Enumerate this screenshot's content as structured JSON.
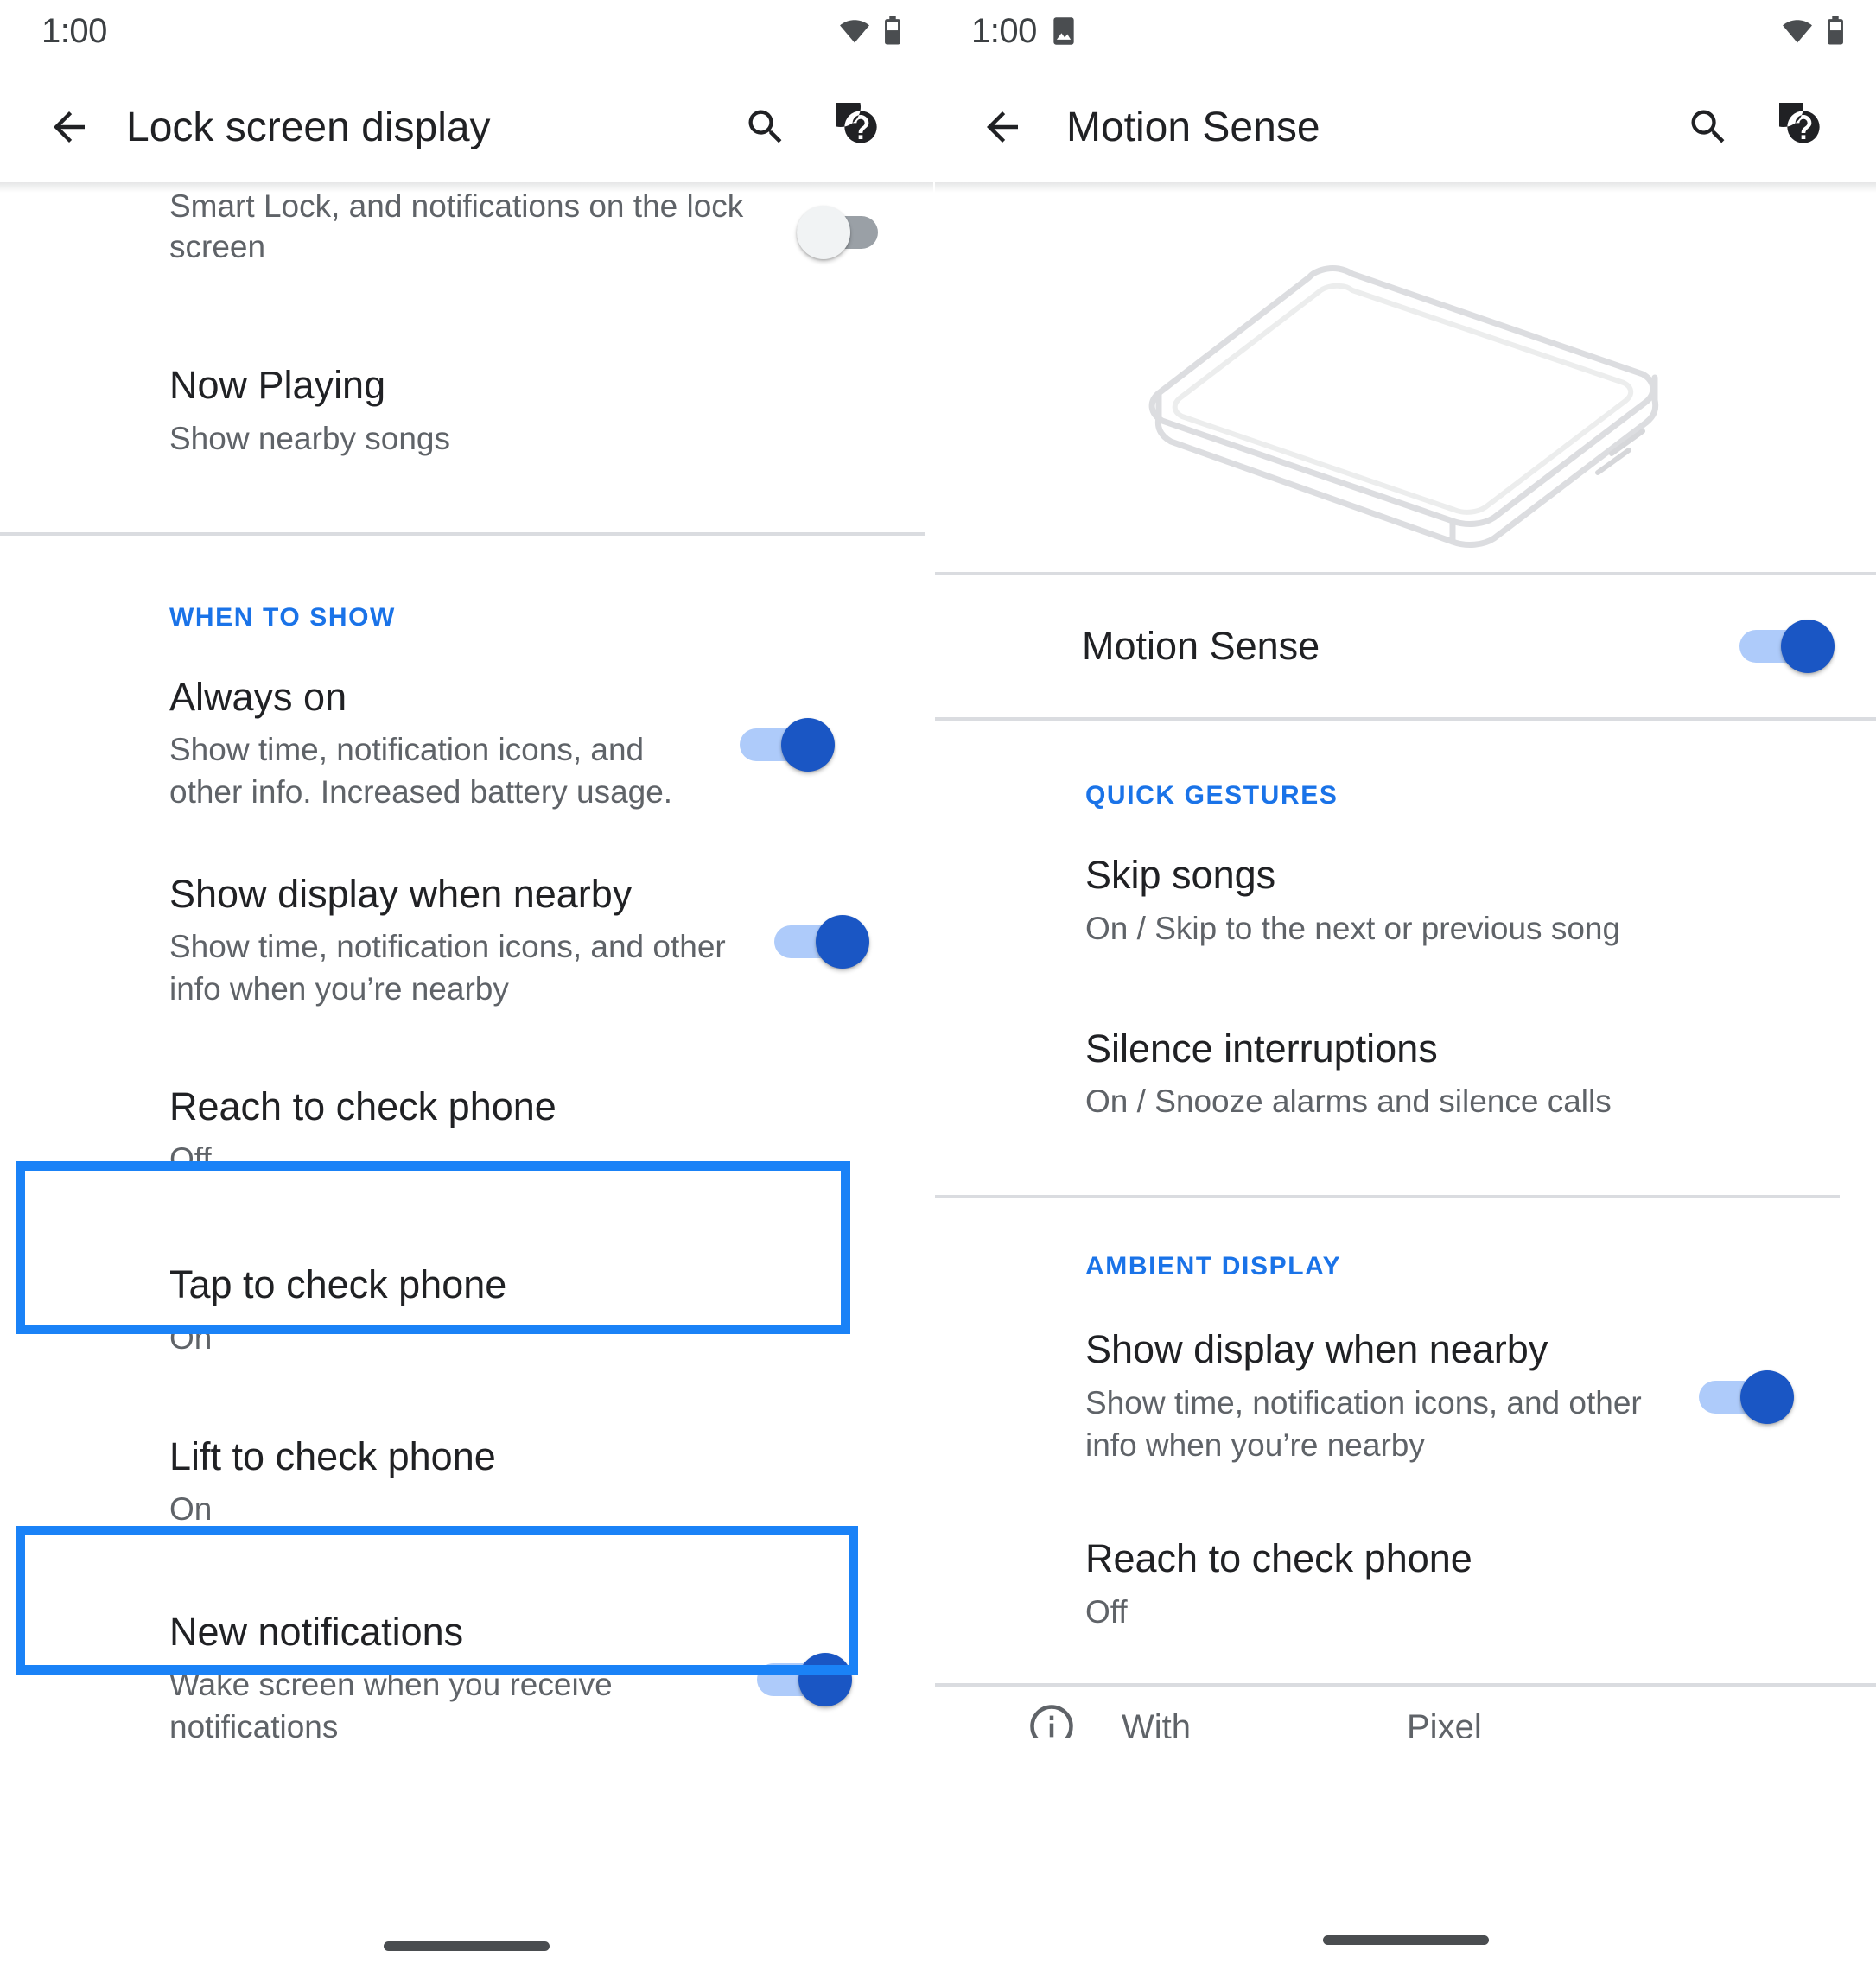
{
  "colors": {
    "accent_blue": "#1a73e8",
    "highlight_blue": "#1a82f7",
    "toggle_on_track": "#aecbfa",
    "toggle_on_thumb": "#1a56c4",
    "toggle_off_track": "#9aa0a6",
    "text_primary": "#202124",
    "text_secondary": "#5f6368",
    "divider": "#dadce0"
  },
  "left_panel": {
    "statusbar": {
      "time": "1:00",
      "icons": [
        "wifi-icon",
        "battery-icon"
      ]
    },
    "appbar": {
      "back_icon": "back-arrow-icon",
      "title": "Lock screen display",
      "search_icon": "search-icon",
      "help_icon": "help-icon"
    },
    "items": [
      {
        "name": "display-power-button-option",
        "title": "",
        "sub": "Display power button option that turns off Smart Lock, and notifications on the lock screen",
        "toggle": "off",
        "clipped_top": true
      },
      {
        "name": "now-playing",
        "title": "Now Playing",
        "sub": "Show nearby songs",
        "toggle": null
      }
    ],
    "section_when_to_show": {
      "header": "WHEN TO SHOW",
      "items": [
        {
          "name": "always-on",
          "title": "Always on",
          "sub": "Show time, notification icons, and other info. Increased battery usage.",
          "toggle": "on"
        },
        {
          "name": "show-display-when-nearby",
          "title": "Show display when nearby",
          "sub": "Show time, notification icons, and other info when you’re nearby",
          "toggle": "on"
        },
        {
          "name": "reach-to-check-phone",
          "title": "Reach to check phone",
          "sub": "Off",
          "toggle": null,
          "highlighted": true
        },
        {
          "name": "tap-to-check-phone",
          "title": "Tap to check phone",
          "sub": "On",
          "toggle": null
        },
        {
          "name": "lift-to-check-phone",
          "title": "Lift to check phone",
          "sub": "On",
          "toggle": null,
          "highlighted": true
        },
        {
          "name": "new-notifications",
          "title": "New notifications",
          "sub": "Wake screen when you receive notifications",
          "toggle": "on"
        }
      ]
    }
  },
  "right_panel": {
    "statusbar": {
      "time": "1:00",
      "icons": [
        "screenshot-icon",
        "wifi-icon",
        "battery-icon"
      ]
    },
    "appbar": {
      "back_icon": "back-arrow-icon",
      "title": "Motion Sense",
      "search_icon": "search-icon",
      "help_icon": "help-icon"
    },
    "illustration": "phone-isometric-illustration",
    "master_toggle": {
      "name": "motion-sense",
      "title": "Motion Sense",
      "toggle": "on",
      "highlighted": true
    },
    "section_quick_gestures": {
      "header": "QUICK GESTURES",
      "items": [
        {
          "name": "skip-songs",
          "title": "Skip songs",
          "sub": "On / Skip to the next or previous song"
        },
        {
          "name": "silence-interruptions",
          "title": "Silence interruptions",
          "sub": "On / Snooze alarms and silence calls"
        }
      ]
    },
    "section_ambient_display": {
      "header": "AMBIENT DISPLAY",
      "highlighted": true,
      "items": [
        {
          "name": "show-display-when-nearby",
          "title": "Show display when nearby",
          "sub": "Show time, notification icons, and other info when you’re nearby",
          "toggle": "on"
        },
        {
          "name": "reach-to-check-phone",
          "title": "Reach to check phone",
          "sub": "Off",
          "toggle": null
        }
      ]
    },
    "footer_note": {
      "icon": "info-icon",
      "text_fragment_left": "With",
      "text_fragment_right": "Pixel"
    }
  }
}
